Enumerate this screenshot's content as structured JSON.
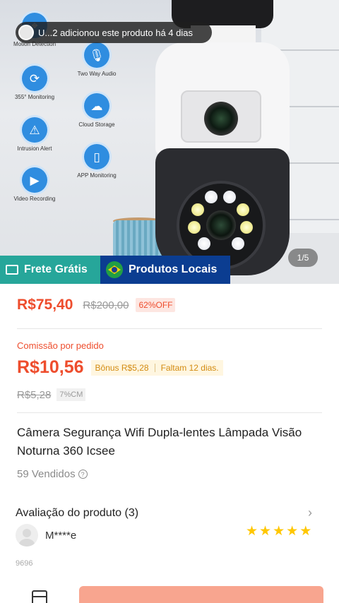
{
  "hero": {
    "features": [
      {
        "label": "Motion Detection",
        "icon": "motion-icon"
      },
      {
        "label": "Two Way Audio",
        "icon": "microphone-icon"
      },
      {
        "label": "355° Monitoring",
        "icon": "rotate-icon"
      },
      {
        "label": "Cloud Storage",
        "icon": "cloud-icon"
      },
      {
        "label": "Intrusion Alert",
        "icon": "alert-icon"
      },
      {
        "label": "APP Monitoring",
        "icon": "phone-icon"
      },
      {
        "label": "Video Recording",
        "icon": "video-icon"
      }
    ],
    "notification": "U...2 adicionou este produto há 4 dias",
    "page_indicator": "1/5"
  },
  "badges": {
    "free_shipping": "Frete Grátis",
    "local_products": "Produtos Locais"
  },
  "price": {
    "current": "R$75,40",
    "original": "R$200,00",
    "discount": "62%OFF"
  },
  "commission": {
    "label": "Comissão por pedido",
    "value": "R$10,56",
    "bonus": "Bônus R$5,28",
    "remaining": "Faltam 12 dias.",
    "old_value": "R$5,28",
    "rate": "7%CM"
  },
  "product": {
    "title": "Câmera Segurança Wifi Dupla-lentes Lâmpada Visão Noturna 360 Icsee",
    "sold": "59 Vendidos"
  },
  "reviews": {
    "heading": "Avaliação do produto (3)",
    "user": "M****e",
    "rating": 5,
    "extra": "9696"
  },
  "colors": {
    "accent": "#ee4d2d",
    "free_shipping": "#26a69a",
    "local_products": "#0b3d91",
    "stars": "#ffc700"
  }
}
